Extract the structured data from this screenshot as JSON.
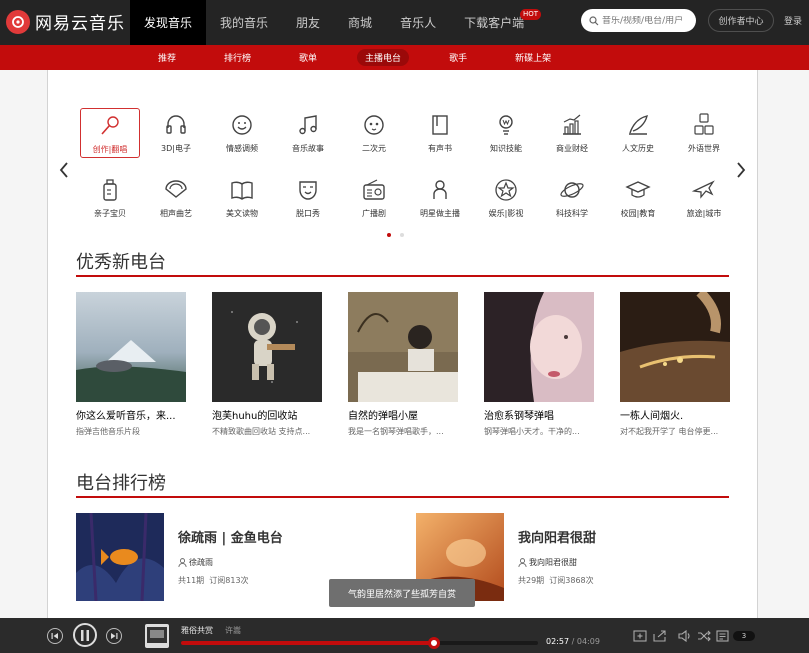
{
  "header": {
    "logo_text": "网易云音乐",
    "nav": [
      {
        "label": "发现音乐",
        "active": true
      },
      {
        "label": "我的音乐"
      },
      {
        "label": "朋友"
      },
      {
        "label": "商城"
      },
      {
        "label": "音乐人"
      },
      {
        "label": "下载客户端",
        "badge": "HOT"
      }
    ],
    "search_placeholder": "音乐/视频/电台/用户",
    "creator_center": "创作者中心",
    "login": "登录"
  },
  "subnav": [
    {
      "label": "推荐"
    },
    {
      "label": "排行榜"
    },
    {
      "label": "歌单"
    },
    {
      "label": "主播电台",
      "active": true
    },
    {
      "label": "歌手"
    },
    {
      "label": "新碟上架"
    }
  ],
  "categories": [
    {
      "label": "创作|翻唱",
      "icon": "microphone-icon",
      "active": true
    },
    {
      "label": "3D|电子",
      "icon": "headphones-icon"
    },
    {
      "label": "情感调频",
      "icon": "smiley-icon"
    },
    {
      "label": "音乐故事",
      "icon": "music-note-icon"
    },
    {
      "label": "二次元",
      "icon": "anime-face-icon"
    },
    {
      "label": "有声书",
      "icon": "book-icon"
    },
    {
      "label": "知识技能",
      "icon": "lightbulb-icon"
    },
    {
      "label": "商业财经",
      "icon": "chart-icon"
    },
    {
      "label": "人文历史",
      "icon": "quill-icon"
    },
    {
      "label": "外语世界",
      "icon": "abc-icon"
    },
    {
      "label": "亲子宝贝",
      "icon": "bottle-icon"
    },
    {
      "label": "相声曲艺",
      "icon": "fan-icon"
    },
    {
      "label": "美文读物",
      "icon": "open-book-icon"
    },
    {
      "label": "脱口秀",
      "icon": "mask-icon"
    },
    {
      "label": "广播剧",
      "icon": "radio-icon"
    },
    {
      "label": "明星做主播",
      "icon": "person-icon"
    },
    {
      "label": "娱乐|影视",
      "icon": "star-icon"
    },
    {
      "label": "科技科学",
      "icon": "planet-icon"
    },
    {
      "label": "校园|教育",
      "icon": "graduation-cap-icon"
    },
    {
      "label": "旅途|城市",
      "icon": "airplane-icon"
    }
  ],
  "sections": {
    "excellent": "优秀新电台",
    "ranking": "电台排行榜"
  },
  "radios": [
    {
      "name": "你这么爱听音乐，来...",
      "desc": "指弹吉他音乐片段"
    },
    {
      "name": "泡芙huhu的回收站",
      "desc": "不精致歌曲回收站 支持点..."
    },
    {
      "name": "自然的弹唱小屋",
      "desc": "我是一名钢琴弹唱歌手，..."
    },
    {
      "name": "治愈系钢琴弹唱",
      "desc": "钢琴弹唱小天才。干净的..."
    },
    {
      "name": "一栋人间烟火.",
      "desc": "对不起我开学了 电台停更..."
    }
  ],
  "rankings": [
    {
      "title": "徐疏雨 | 金鱼电台",
      "author": "徐疏雨",
      "episodes": "共11期",
      "subs": "订阅813次"
    },
    {
      "title": "我向阳君很甜",
      "author": "我向阳君很甜",
      "episodes": "共29期",
      "subs": "订阅3868次"
    }
  ],
  "toast": "气韵里居然添了些孤芳自赏",
  "player": {
    "song": "雅俗共赏",
    "artist": "许嵩",
    "current": "02:57",
    "duration": "/ 04:09",
    "progress": 0.71,
    "playlist_count": "3"
  }
}
